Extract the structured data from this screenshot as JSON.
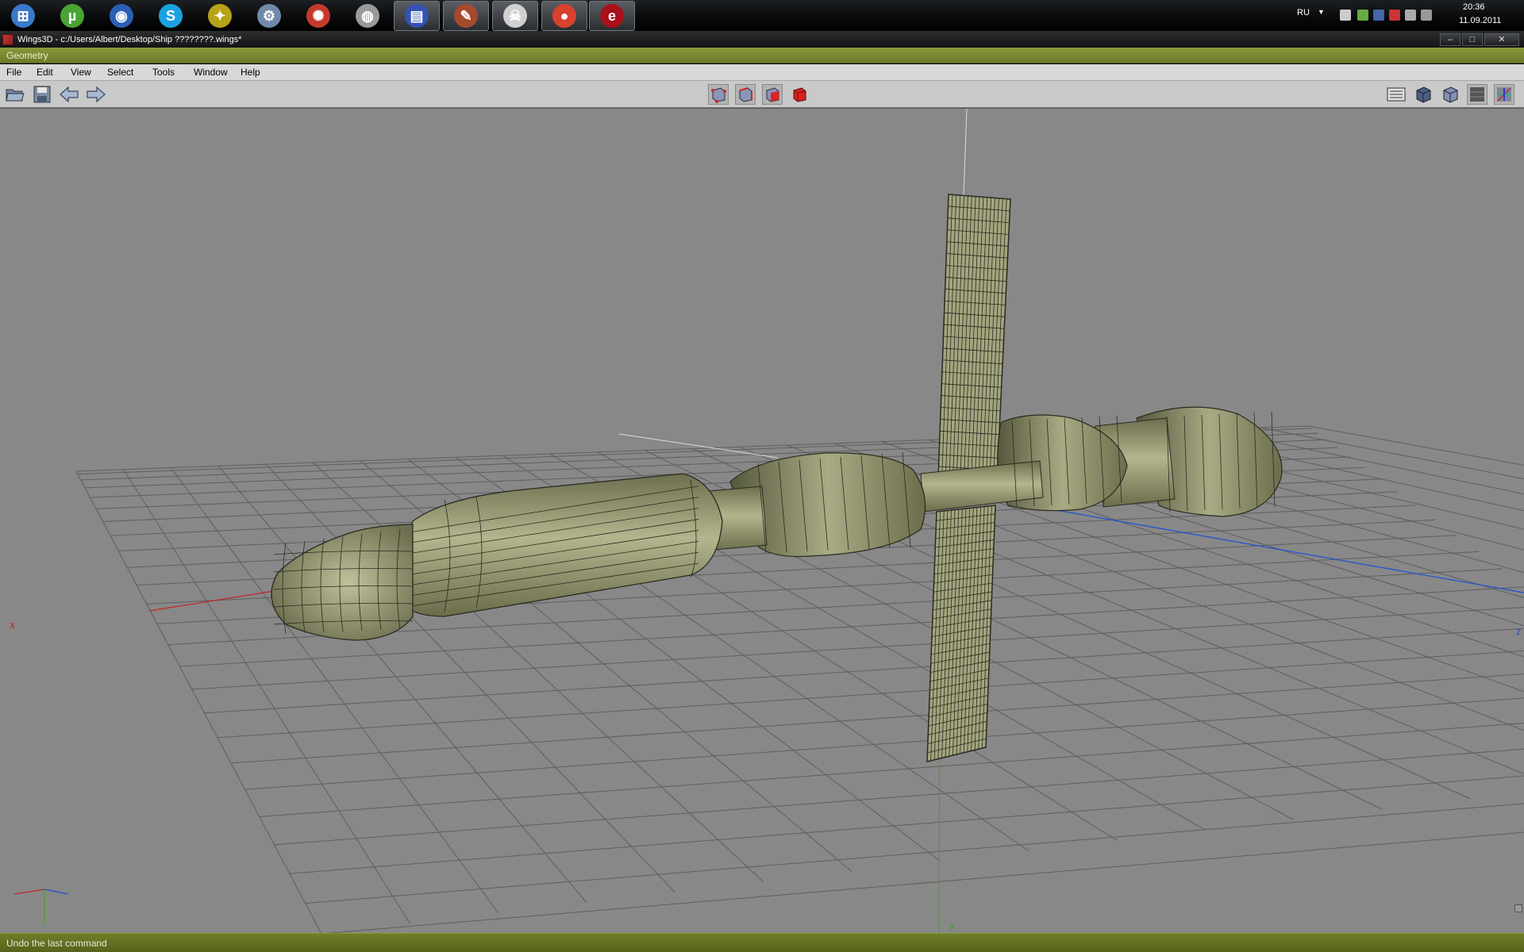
{
  "taskbar": {
    "apps": [
      {
        "name": "start",
        "icon": "windows-orb-icon",
        "glyph": "⊞",
        "color": "#3a78c9"
      },
      {
        "name": "utorrent",
        "icon": "utorrent-icon",
        "glyph": "µ",
        "color": "#4aa335"
      },
      {
        "name": "google-earth",
        "icon": "google-earth-icon",
        "glyph": "◉",
        "color": "#2a5fb5"
      },
      {
        "name": "skype",
        "icon": "skype-icon",
        "glyph": "S",
        "color": "#1aa3e0"
      },
      {
        "name": "app-yellow",
        "icon": "yellow-robot-icon",
        "glyph": "✦",
        "color": "#b7a319"
      },
      {
        "name": "app-tools",
        "icon": "tools-icon",
        "glyph": "⚙",
        "color": "#6f8aa8"
      },
      {
        "name": "app-red",
        "icon": "red-swirl-icon",
        "glyph": "✺",
        "color": "#c33a2b"
      },
      {
        "name": "speaker",
        "icon": "speaker-icon",
        "glyph": "◍",
        "color": "#9a9a9a"
      },
      {
        "name": "floppy",
        "icon": "floppy-disk-icon",
        "glyph": "▤",
        "color": "#3452b4"
      },
      {
        "name": "app-brush",
        "icon": "brush-icon",
        "glyph": "✎",
        "color": "#a64a2e"
      },
      {
        "name": "app-skull",
        "icon": "skull-icon",
        "glyph": "☠",
        "color": "#d0d0d0"
      },
      {
        "name": "chrome",
        "icon": "chrome-icon",
        "glyph": "●",
        "color": "#d9412f"
      },
      {
        "name": "erlang",
        "icon": "erlang-icon",
        "glyph": "e",
        "color": "#a8101a"
      }
    ],
    "tray": {
      "language": "RU",
      "time": "20:36",
      "date": "11.09.2011"
    }
  },
  "window": {
    "title": "Wings3D - c:/Users/Albert/Desktop/Ship ????????.wings*",
    "minimize": "–",
    "maximize": "□",
    "close": "✕"
  },
  "geometry_label": "Geometry",
  "menu": [
    "File",
    "Edit",
    "View",
    "Select",
    "Tools",
    "Window",
    "Help"
  ],
  "toolbar": {
    "left": [
      {
        "name": "open-icon"
      },
      {
        "name": "save-icon"
      },
      {
        "name": "undo-icon"
      },
      {
        "name": "redo-icon"
      }
    ],
    "selection_modes": [
      {
        "name": "vertex-mode-icon"
      },
      {
        "name": "edge-mode-icon"
      },
      {
        "name": "face-mode-icon"
      },
      {
        "name": "body-mode-icon",
        "active": true
      }
    ],
    "right": [
      {
        "name": "groundplane-icon"
      },
      {
        "name": "smooth-shading-icon"
      },
      {
        "name": "ortho-icon"
      },
      {
        "name": "wireframe-icon"
      },
      {
        "name": "axes-icon"
      }
    ]
  },
  "viewport": {
    "x_axis_label": "x",
    "y_axis_label": "y",
    "z_axis_label": "z",
    "colors": {
      "background": "#888888",
      "grid": "#5e5e5e",
      "x_axis": "#c0262a",
      "y_axis": "#3ca326",
      "z_axis": "#1f4fd6",
      "mesh": "#9b9d77",
      "mesh_dark": "#5c5e43",
      "edges": "#2a2a20"
    }
  },
  "status": "Undo the last command"
}
